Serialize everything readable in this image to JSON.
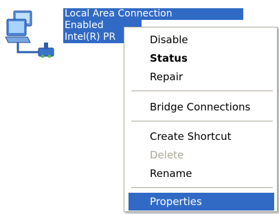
{
  "connection": {
    "name": "Local Area Connection",
    "status": "Enabled",
    "device": "Intel(R) PR",
    "icon": "network-connection-icon",
    "selection_color": "#316ac5"
  },
  "context_menu": {
    "items": [
      {
        "label": "Disable",
        "style": "normal"
      },
      {
        "label": "Status",
        "style": "bold"
      },
      {
        "label": "Repair",
        "style": "normal"
      },
      {
        "label": "Bridge Connections",
        "style": "normal"
      },
      {
        "label": "Create Shortcut",
        "style": "normal"
      },
      {
        "label": "Delete",
        "style": "disabled"
      },
      {
        "label": "Rename",
        "style": "normal"
      },
      {
        "label": "Properties",
        "style": "selected"
      }
    ],
    "highlight_color": "#316ac5",
    "disabled_color": "#aca899"
  }
}
